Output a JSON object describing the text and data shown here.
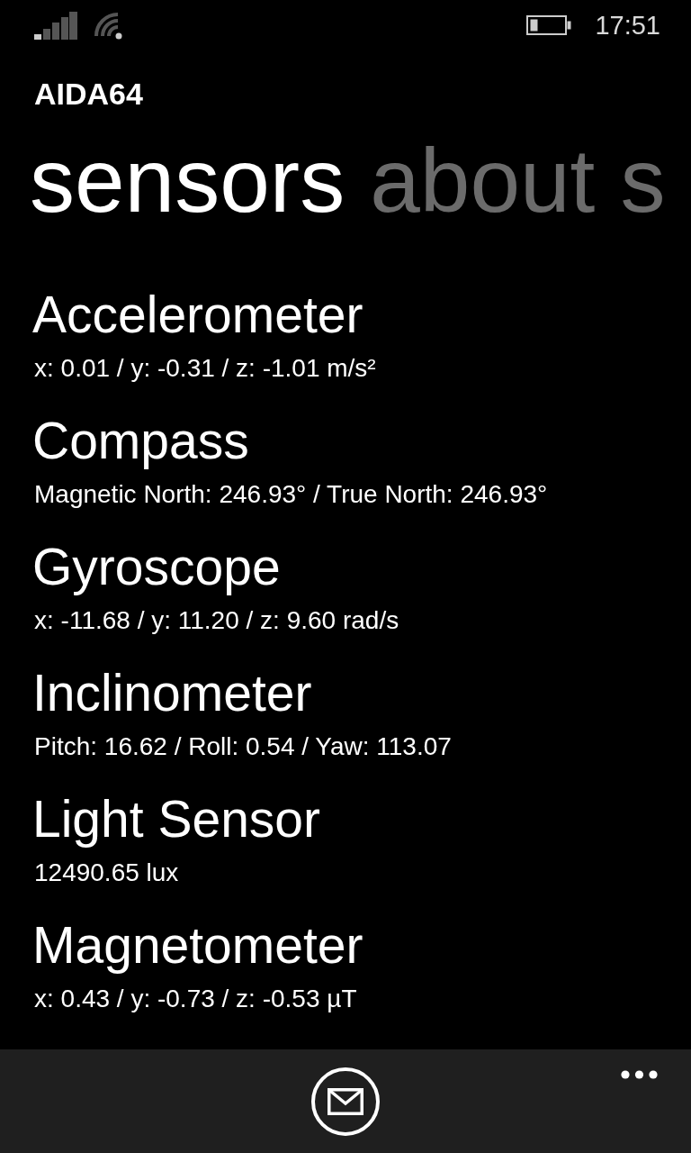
{
  "status_bar": {
    "time": "17:51"
  },
  "app": {
    "title": "AIDA64"
  },
  "pivot": [
    {
      "label": "sensors",
      "selected": true
    },
    {
      "label": "about",
      "selected": false
    },
    {
      "label": "s",
      "selected": false
    }
  ],
  "sensors": [
    {
      "name": "Accelerometer",
      "reading": "x: 0.01 / y: -0.31 / z: -1.01 m/s²"
    },
    {
      "name": "Compass",
      "reading": "Magnetic North: 246.93° / True North: 246.93°"
    },
    {
      "name": "Gyroscope",
      "reading": "x: -11.68 / y: 11.20 / z: 9.60 rad/s"
    },
    {
      "name": "Inclinometer",
      "reading": "Pitch: 16.62 / Roll: 0.54 / Yaw: 113.07"
    },
    {
      "name": "Light Sensor",
      "reading": "12490.65 lux"
    },
    {
      "name": "Magnetometer",
      "reading": "x: 0.43 / y: -0.73 / z: -0.53 µT"
    }
  ]
}
